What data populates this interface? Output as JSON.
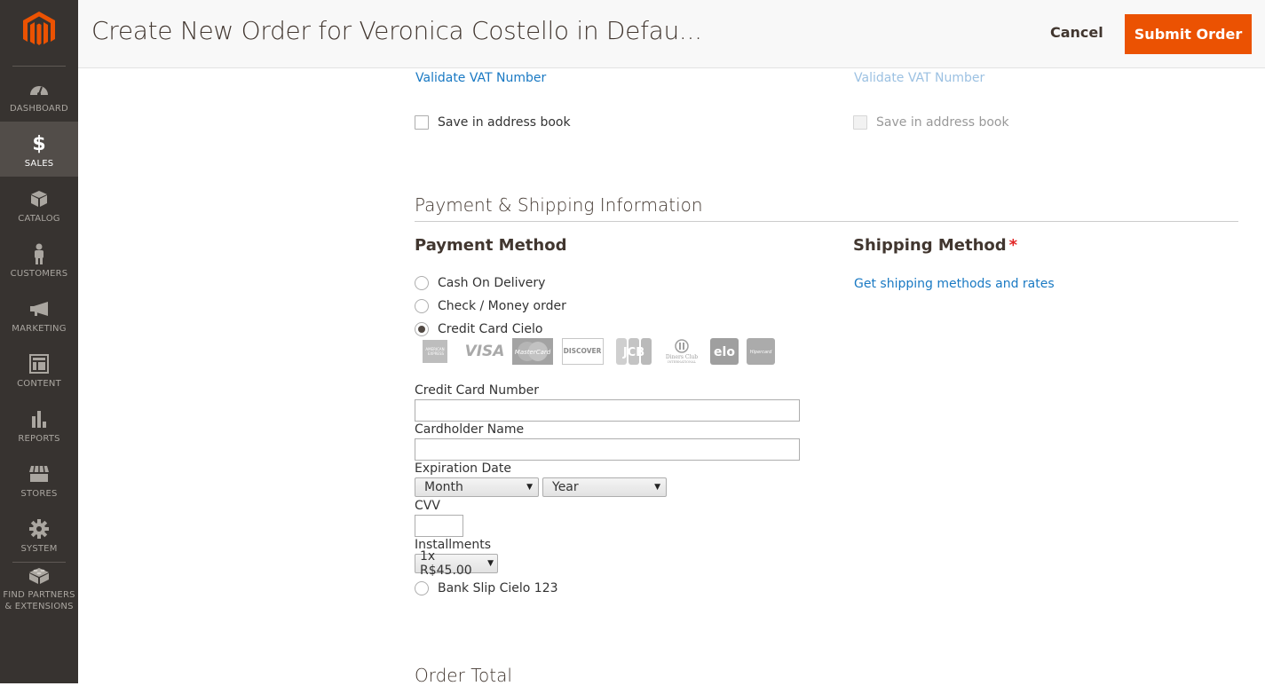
{
  "header": {
    "title": "Create New Order for Veronica Costello in Defau...",
    "cancel_label": "Cancel",
    "submit_label": "Submit Order"
  },
  "sidebar": {
    "items": [
      {
        "label": "DASHBOARD",
        "icon": "dashboard-icon",
        "active": false
      },
      {
        "label": "SALES",
        "icon": "dollar-icon",
        "active": true
      },
      {
        "label": "CATALOG",
        "icon": "box-icon",
        "active": false
      },
      {
        "label": "CUSTOMERS",
        "icon": "person-icon",
        "active": false
      },
      {
        "label": "MARKETING",
        "icon": "megaphone-icon",
        "active": false
      },
      {
        "label": "CONTENT",
        "icon": "layout-icon",
        "active": false
      },
      {
        "label": "REPORTS",
        "icon": "bar-chart-icon",
        "active": false
      },
      {
        "label": "STORES",
        "icon": "storefront-icon",
        "active": false
      },
      {
        "label": "SYSTEM",
        "icon": "gear-icon",
        "active": false
      },
      {
        "label": "FIND PARTNERS & EXTENSIONS",
        "label_line1": "FIND PARTNERS",
        "label_line2": "& EXTENSIONS",
        "icon": "lego-block-icon",
        "active": false
      }
    ]
  },
  "address": {
    "billing": {
      "validate_vat_label": "Validate VAT Number",
      "save_address_label": "Save in address book",
      "save_address_checked": false
    },
    "shipping": {
      "validate_vat_label": "Validate VAT Number",
      "save_address_label": "Save in address book",
      "save_address_checked": false,
      "disabled": true
    }
  },
  "payment_shipping": {
    "section_title": "Payment & Shipping Information",
    "payment": {
      "title": "Payment Method",
      "methods": [
        {
          "label": "Cash On Delivery",
          "checked": false
        },
        {
          "label": "Check / Money order",
          "checked": false
        },
        {
          "label": "Credit Card Cielo",
          "checked": true
        },
        {
          "label": "Bank Slip Cielo 123",
          "checked": false
        }
      ],
      "card_brands": [
        "American Express",
        "VISA",
        "MasterCard",
        "DISCOVER",
        "JCB",
        "Diners Club International",
        "elo",
        "Hipercard"
      ],
      "credit_card_form": {
        "number_label": "Credit Card Number",
        "number_value": "",
        "holder_label": "Cardholder Name",
        "holder_value": "",
        "expiration_label": "Expiration Date",
        "month_selected": "Month",
        "year_selected": "Year",
        "cvv_label": "CVV",
        "cvv_value": "",
        "installments_label": "Installments",
        "installments_selected": "1x R$45.00"
      }
    },
    "shipping": {
      "title": "Shipping Method",
      "required_mark": "*",
      "get_rates_label": "Get shipping methods and rates"
    }
  },
  "order_total": {
    "title": "Order Total"
  },
  "colors": {
    "accent": "#eb5202",
    "sidebar_bg": "#373330",
    "sidebar_active": "#524d49",
    "link": "#1979c3"
  }
}
